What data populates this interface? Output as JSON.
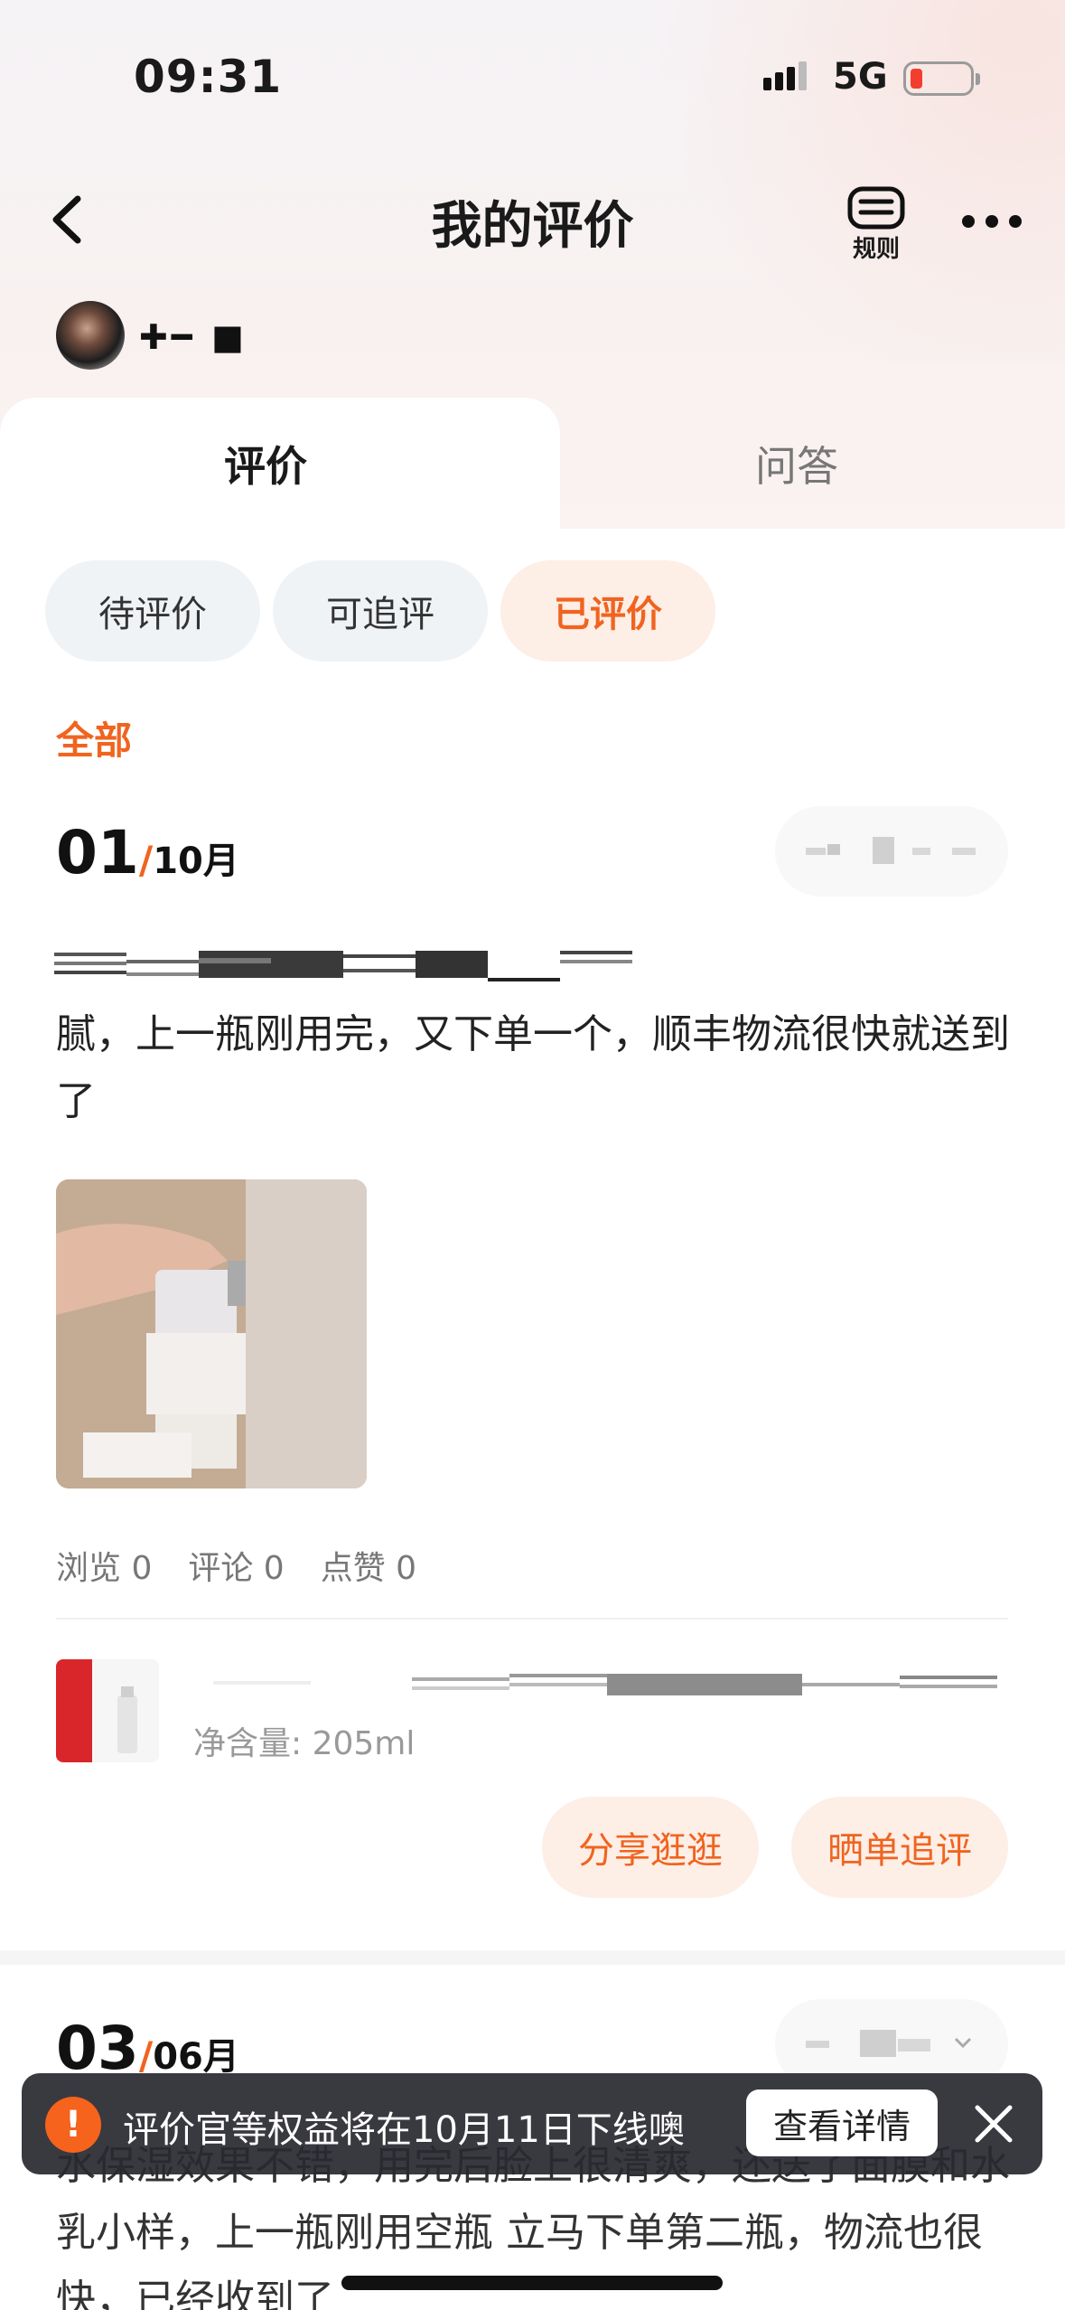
{
  "status_bar": {
    "time": "09:31",
    "network": "5G"
  },
  "nav": {
    "title": "我的评价",
    "rules_label": "规则"
  },
  "user": {
    "name": "✚━ ■"
  },
  "tabs": [
    {
      "label": "评价"
    },
    {
      "label": "问答"
    }
  ],
  "filters": [
    {
      "label": "待评价"
    },
    {
      "label": "可追评"
    },
    {
      "label": "已评价"
    }
  ],
  "section_label": "全部",
  "reviews": [
    {
      "day": "01",
      "month": "10月",
      "text": "腻，上一瓶刚用完，又下单一个，顺丰物流很快就送到了",
      "stats": {
        "views": "浏览 0",
        "comments": "评论 0",
        "likes": "点赞 0"
      },
      "product_spec": "净含量: 205ml",
      "buttons": {
        "share": "分享逛逛",
        "follow_up": "晒单追评"
      }
    },
    {
      "day": "03",
      "month": "06月",
      "text": "水保湿效果不错，用完后脸上很清爽，还送了面膜和水乳小样，上一瓶刚用空瓶 立马下单第二瓶，物流也很快，已经收到了"
    }
  ],
  "toast": {
    "message": "评价官等权益将在10月11日下线噢",
    "detail_button": "查看详情"
  }
}
